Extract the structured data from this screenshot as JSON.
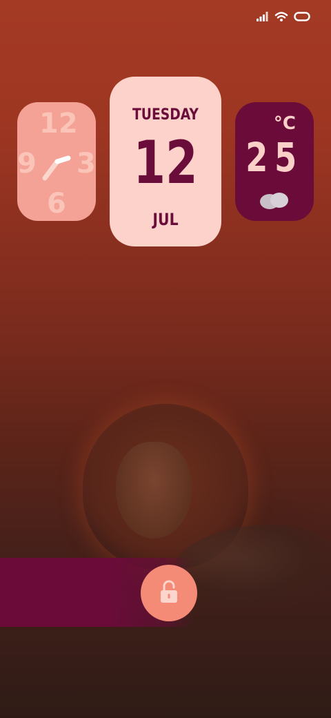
{
  "status_bar": {
    "signal_icon": "signal-bars-icon",
    "wifi_icon": "wifi-icon",
    "battery_icon": "battery-icon"
  },
  "clock_widget": {
    "numerals": [
      "12",
      "3",
      "6",
      "9"
    ],
    "hand_color": "#ffffff"
  },
  "date_widget": {
    "weekday": "TUESDAY",
    "day": "12",
    "month": "JUL"
  },
  "weather_widget": {
    "unit": "°C",
    "temperature": "25",
    "condition_icon": "cloud-icon"
  },
  "lock": {
    "unlock_icon": "unlock-icon"
  },
  "colors": {
    "accent_dark": "#6b0b3a",
    "accent_light": "#fdd2ca",
    "clock_bg": "#f4a295",
    "unlock_button": "#f38b76"
  }
}
